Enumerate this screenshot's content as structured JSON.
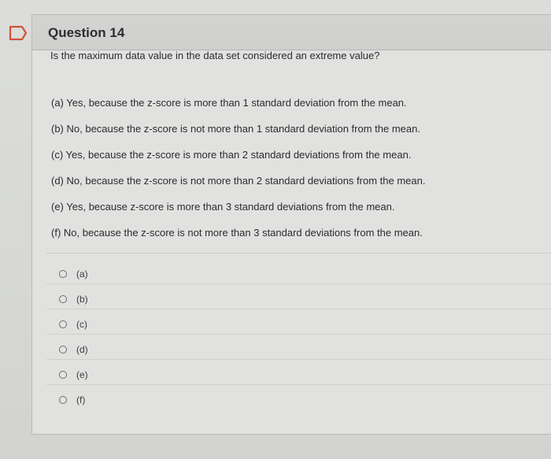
{
  "question": {
    "title": "Question 14",
    "prompt": "Is the maximum data value in the data set considered an extreme value?",
    "choices": [
      "(a) Yes, because the z-score is more than 1 standard deviation from the mean.",
      "(b) No, because the z-score is not more than 1 standard deviation from the mean.",
      "(c) Yes, because the z-score is more than 2 standard deviations from the mean.",
      "(d) No, because the z-score is not more than 2 standard deviations from the mean.",
      "(e) Yes, because z-score is more than 3 standard deviations from the mean.",
      "(f) No, because the z-score is not more than 3 standard deviations from the mean."
    ],
    "options": [
      "(a)",
      "(b)",
      "(c)",
      "(d)",
      "(e)",
      "(f)"
    ]
  },
  "colors": {
    "background": "#d9dad8",
    "header": "#d1d2d0",
    "text": "#2a2b2d",
    "flag_outline": "#d2513a"
  },
  "icons": {
    "flag": "bookmark-flag-icon",
    "radio": "radio-button-icon"
  }
}
